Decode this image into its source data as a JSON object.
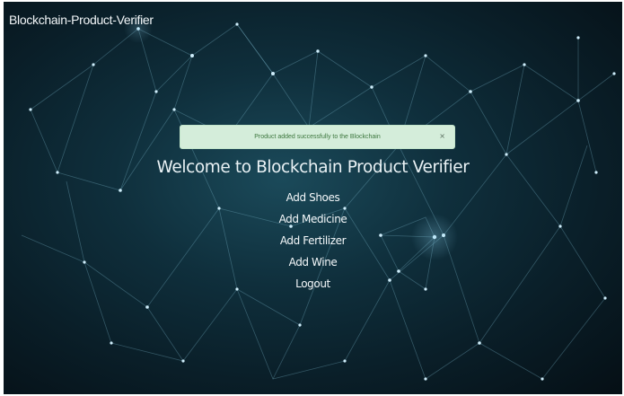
{
  "navbar": {
    "brand": "Blockchain-Product-Verifier"
  },
  "alert": {
    "message": "Product added successfully to the Blockchain",
    "close_label": "×",
    "color": "#d4edda"
  },
  "main": {
    "heading": "Welcome to Blockchain Product Verifier",
    "menu": [
      "Add Shoes",
      "Add Medicine",
      "Add Fertilizer",
      "Add Wine",
      "Logout"
    ]
  },
  "theme": {
    "background": "#0a1f29",
    "text": "#eaf2f5"
  }
}
